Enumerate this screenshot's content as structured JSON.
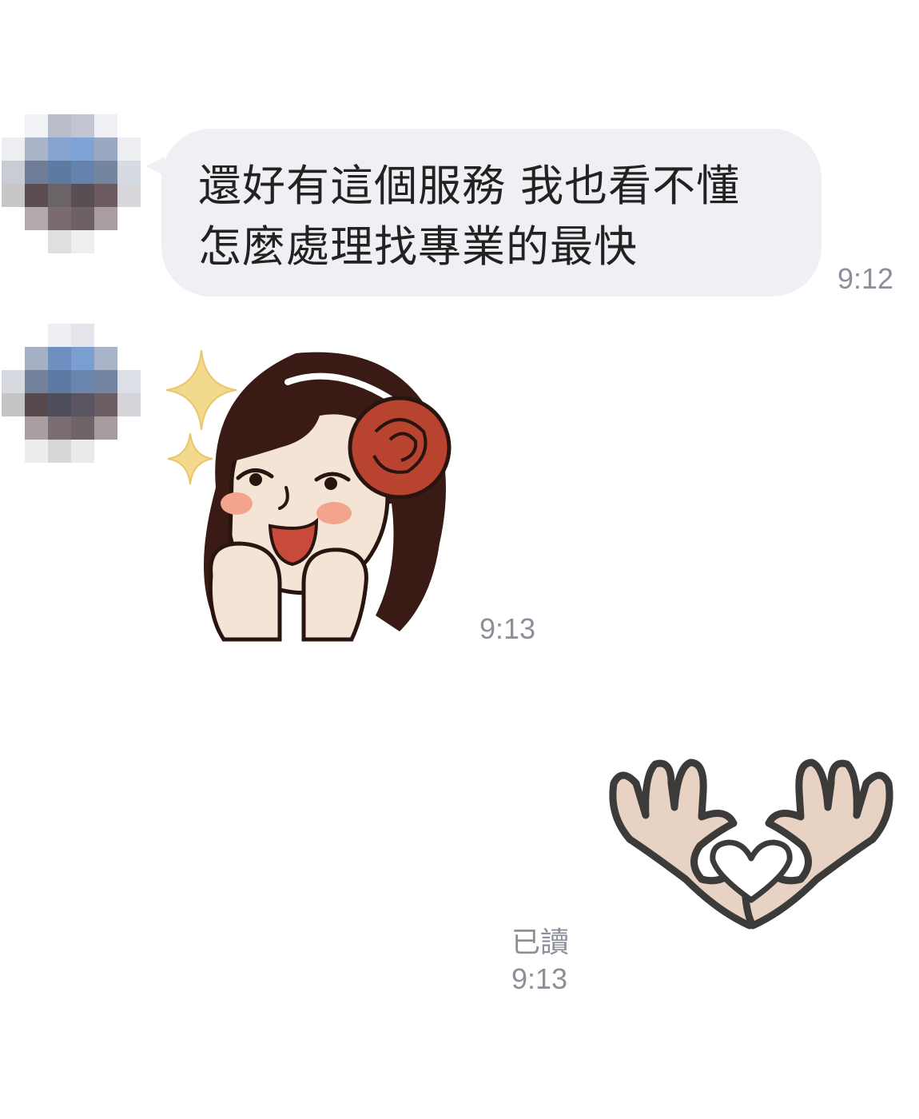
{
  "messages": [
    {
      "sender": "other",
      "kind": "text",
      "lines": [
        "還好有這個服務 我也看不懂",
        "怎麼處理找專業的最快"
      ],
      "time": "9:12"
    },
    {
      "sender": "other",
      "kind": "sticker",
      "sticker_icon": "girl-with-rose-sticker-icon",
      "time": "9:13"
    },
    {
      "sender": "me",
      "kind": "sticker",
      "sticker_icon": "heart-hands-sticker-icon",
      "read_label": "已讀",
      "time": "9:13"
    }
  ],
  "colors": {
    "bubble_background": "#eef0f3",
    "bubble_text": "#222222",
    "timestamp": "#8a8f98",
    "page_background": "#ffffff"
  }
}
